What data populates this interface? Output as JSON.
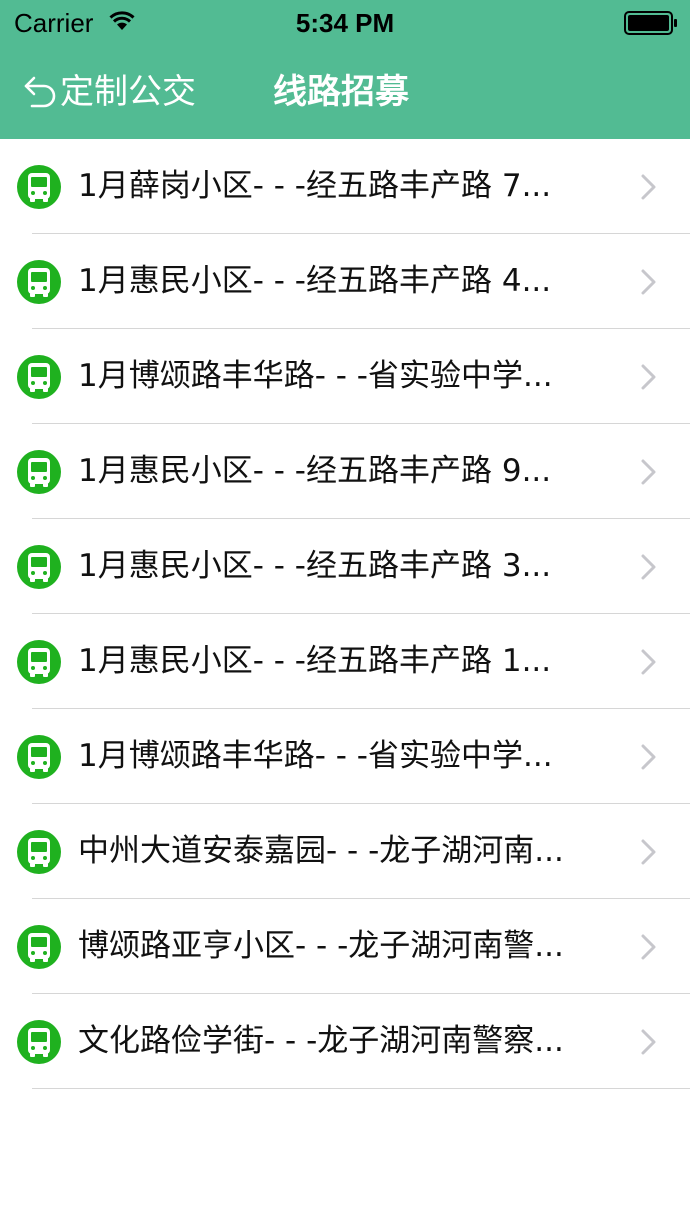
{
  "status_bar": {
    "carrier": "Carrier",
    "time": "5:34 PM"
  },
  "nav": {
    "back_label": "定制公交",
    "title": "线路招募",
    "bar_color": "#52bb93"
  },
  "routes": [
    {
      "title": "1月薛岗小区- - -经五路丰产路 7..."
    },
    {
      "title": "1月惠民小区- - -经五路丰产路 4..."
    },
    {
      "title": "1月博颂路丰华路- - -省实验中学..."
    },
    {
      "title": "1月惠民小区- - -经五路丰产路 9..."
    },
    {
      "title": "1月惠民小区- - -经五路丰产路 3..."
    },
    {
      "title": "1月惠民小区- - -经五路丰产路 1..."
    },
    {
      "title": "1月博颂路丰华路- - -省实验中学..."
    },
    {
      "title": "中州大道安泰嘉园- - -龙子湖河南..."
    },
    {
      "title": "博颂路亚亨小区- - -龙子湖河南警..."
    },
    {
      "title": "文化路俭学街- - -龙子湖河南警察..."
    }
  ],
  "icons": {
    "route": "bus-icon",
    "disclosure": "chevron-right-icon",
    "back": "back-arrow-icon",
    "accent": "#1fb11f"
  }
}
